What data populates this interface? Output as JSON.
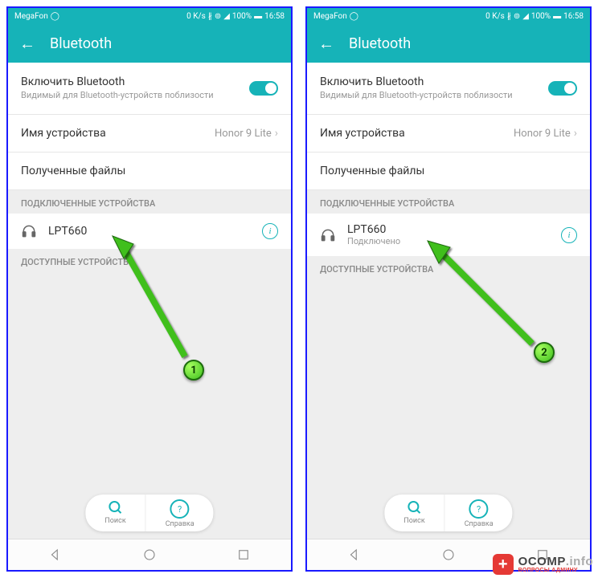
{
  "status": {
    "carrier": "MegaFon",
    "speed": "0 K/s",
    "battery": "100%",
    "time": "16:58"
  },
  "header": {
    "title": "Bluetooth"
  },
  "bluetooth": {
    "enable_label": "Включить Bluetooth",
    "enable_sub": "Видимый для Bluetooth-устройств поблизости",
    "device_name_label": "Имя устройства",
    "device_name_value": "Honor 9 Lite",
    "received_files_label": "Полученные файлы",
    "connected_section": "ПОДКЛЮЧЕННЫЕ УСТРОЙСТВА",
    "available_section": "ДОСТУПНЫЕ УСТРОЙСТВА",
    "available_section_short": "ДОСТУПНЫЕ УСТРОЙСТВ"
  },
  "device": {
    "name": "LPT660",
    "status": "Подключено"
  },
  "bottom": {
    "search": "Поиск",
    "help": "Справка"
  },
  "annotations": {
    "a1": "1",
    "a2": "2"
  },
  "watermark": {
    "brand": "OCOMP",
    "suffix": ".info",
    "tag": "ВОПРОСЫ АДМИНУ"
  }
}
